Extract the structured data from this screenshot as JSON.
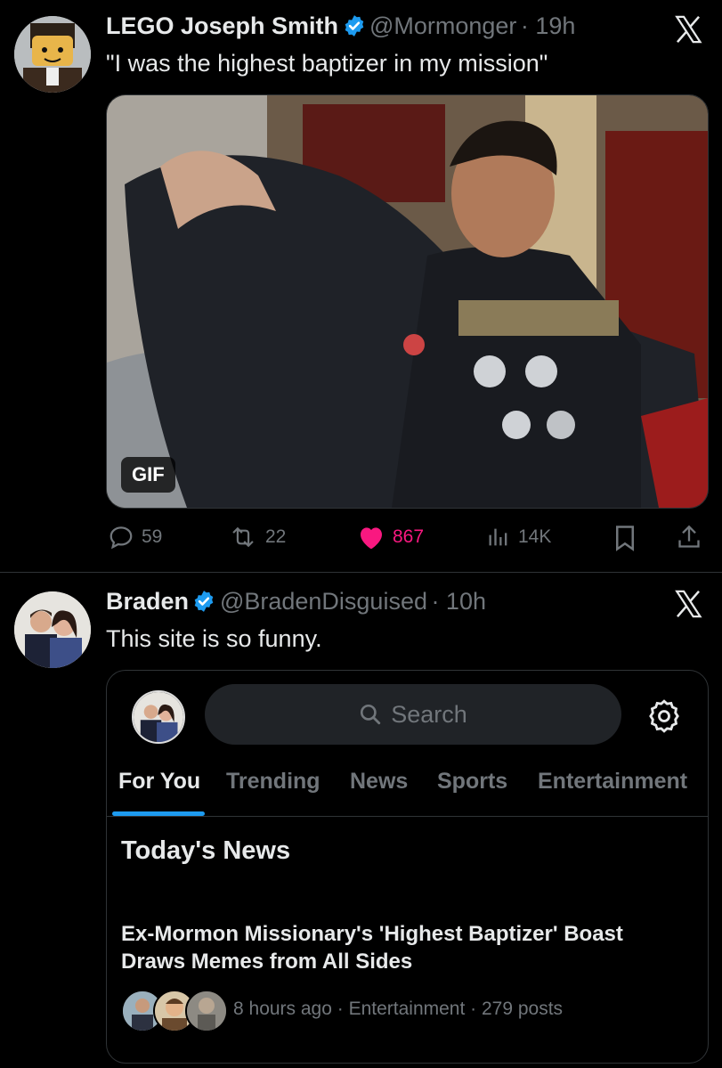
{
  "tweets": [
    {
      "author_name": "LEGO Joseph Smith",
      "handle": "@Mormonger",
      "time": "· 19h",
      "text": "\"I was the highest baptizer in my mission\"",
      "media_badge": "GIF",
      "stats": {
        "replies": "59",
        "reposts": "22",
        "likes": "867",
        "views": "14K"
      },
      "platform_icon": "x-logo-icon"
    },
    {
      "author_name": "Braden",
      "handle": "@BradenDisguised",
      "time": "· 10h",
      "text": "This site is so funny.",
      "platform_icon": "x-logo-icon"
    }
  ],
  "embedded": {
    "search_placeholder": "Search",
    "tabs": [
      "For You",
      "Trending",
      "News",
      "Sports",
      "Entertainment"
    ],
    "active_tab": "For You",
    "section_title": "Today's News",
    "headline": "Ex-Mormon Missionary's 'Highest Baptizer' Boast Draws Memes from All Sides",
    "meta": "8 hours ago · Entertainment · 279 posts"
  },
  "colors": {
    "accent": "#1d9bf0",
    "like": "#f91880",
    "verified": "#1d9bf0"
  }
}
